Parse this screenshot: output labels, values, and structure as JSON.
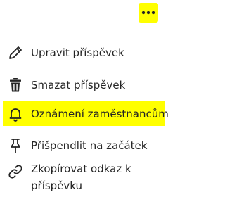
{
  "toolbar": {
    "more_icon": "more-horizontal-icon",
    "highlight_color": "#ffff00"
  },
  "menu": {
    "items": [
      {
        "id": "edit",
        "icon": "pencil-icon",
        "label": "Upravit příspěvek"
      },
      {
        "id": "delete",
        "icon": "trash-icon",
        "label": "Smazat příspěvek"
      },
      {
        "id": "announce",
        "icon": "bell-icon",
        "label": "Oznámení zaměstnancům",
        "highlighted": true
      },
      {
        "id": "pin",
        "icon": "pin-icon",
        "label": "Přišpendlit na začátek"
      },
      {
        "id": "copy-link",
        "icon": "link-icon",
        "label_line1": "Zkopírovat odkaz k",
        "label_line2": "příspěvku"
      }
    ]
  }
}
